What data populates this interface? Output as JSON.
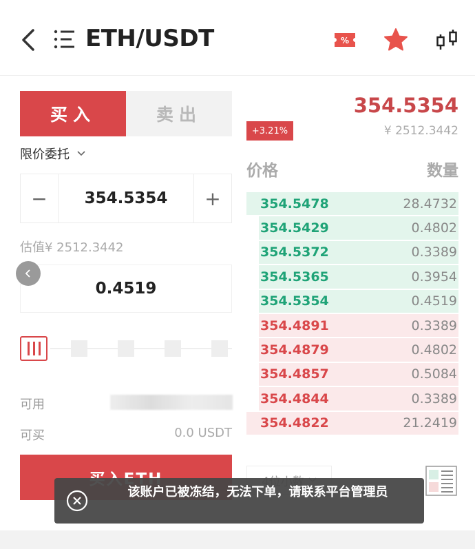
{
  "header": {
    "title": "ETH/USDT",
    "icons": [
      "back-icon",
      "menu-icon",
      "percent-tag-icon",
      "star-icon",
      "candlestick-icon"
    ]
  },
  "trade": {
    "buy_tab": "买入",
    "sell_tab": "卖出",
    "order_type": "限价委托",
    "price_value": "354.5354",
    "minus_label": "−",
    "plus_label": "+",
    "estimate": "估值¥ 2512.3442",
    "quantity_value": "0.4519",
    "available_label": "可用",
    "canbuy_label": "可买",
    "canbuy_value": "0.0 USDT",
    "buy_button": "买入ETH"
  },
  "market": {
    "last_price": "354.5354",
    "change": "+3.21%",
    "cny_price": "¥ 2512.3442",
    "price_header": "价格",
    "qty_header": "数量"
  },
  "orderbook": [
    {
      "price": "354.5478",
      "qty": "28.4732",
      "side": "buy",
      "depth": 1.0
    },
    {
      "price": "354.5429",
      "qty": "0.4802",
      "side": "buy",
      "depth": 0.94
    },
    {
      "price": "354.5372",
      "qty": "0.3389",
      "side": "buy",
      "depth": 0.94
    },
    {
      "price": "354.5365",
      "qty": "0.3954",
      "side": "buy",
      "depth": 0.94
    },
    {
      "price": "354.5354",
      "qty": "0.4519",
      "side": "buy",
      "depth": 0.94
    },
    {
      "price": "354.4891",
      "qty": "0.3389",
      "side": "sell",
      "depth": 0.94
    },
    {
      "price": "354.4879",
      "qty": "0.4802",
      "side": "sell",
      "depth": 0.94
    },
    {
      "price": "354.4857",
      "qty": "0.5084",
      "side": "sell",
      "depth": 0.94
    },
    {
      "price": "354.4844",
      "qty": "0.3389",
      "side": "sell",
      "depth": 0.94
    },
    {
      "price": "354.4822",
      "qty": "21.2419",
      "side": "sell",
      "depth": 1.0
    }
  ],
  "depth_select": "4位小数",
  "toast": {
    "message": "该账户已被冻结，无法下单，请联系平台管理员"
  },
  "colors": {
    "red": "#d9474a",
    "green": "#1fa377",
    "green_bg": "#e3f5ec",
    "red_bg": "#fbe9ea"
  }
}
